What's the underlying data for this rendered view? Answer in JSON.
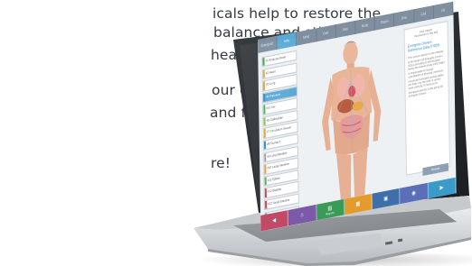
{
  "copy": {
    "lines": [
      "icals help to restore the",
      "balance and stimulates",
      "healing responses.",
      "our clients supple,",
      "and fit.",
      "re!"
    ]
  },
  "screen": {
    "tabs": [
      {
        "label": "Energetic"
      },
      {
        "label": "Info",
        "active": true
      },
      {
        "label": "Mind"
      },
      {
        "label": "Diet"
      },
      {
        "label": "Skin"
      },
      {
        "label": "Body"
      },
      {
        "label": "Organ"
      },
      {
        "label": "Dna"
      },
      {
        "label": "Cell"
      },
      {
        "label": "Oil"
      }
    ],
    "left_items": [
      {
        "label": "#1 Anatomy Brain",
        "color": "#3aa84b"
      },
      {
        "label": "#2 Heart",
        "color": "#e4a23a"
      },
      {
        "label": "#3 Lung",
        "color": "#e4a23a"
      },
      {
        "label": "#4 Pancreas",
        "color": "#2f8fcc",
        "sel": true
      },
      {
        "label": "#5 Liver",
        "color": "#4caf50"
      },
      {
        "label": "#6 Gallbladder",
        "color": "#8bc34a"
      },
      {
        "label": "#7 Circulation Sexual",
        "color": "#e4a23a"
      },
      {
        "label": "#8 Stomach",
        "color": "#2f8fcc"
      },
      {
        "label": "#9 Lung Meridian",
        "color": "#9e9e9e"
      },
      {
        "label": "#10 Large Intestine",
        "color": "#e4a23a"
      },
      {
        "label": "#11 Spleen",
        "color": "#4caf50"
      },
      {
        "label": "#12 Bladder",
        "color": "#e53935"
      },
      {
        "label": "#13 Small Intestine",
        "color": "#e53935"
      },
      {
        "label": "#14 Kidney",
        "color": "#2f8fcc"
      },
      {
        "label": "#15 Thymus",
        "color": "#e53935"
      },
      {
        "label": "#16 Thyroid",
        "color": "#9e9e9e"
      },
      {
        "label": "#17 Lymph",
        "color": "#4caf50"
      },
      {
        "label": "#18 Skin",
        "color": "#e53935"
      }
    ],
    "right_panel": {
      "title_top": "Paul Casper",
      "title_top2": "Introduction to this tool",
      "heading": "Energetic Drivers Reference Data (HD)®",
      "text": "This screen reports on the integrity of the body's 18 Energetic Drivers (EDs) according to bioenergetic theory the Human Body Field (HBF) is responsible for overall coordination of physical, chemical, neural and energetic activity within the body. For the HBF to do this work correctly, it needs to be energized and this is the job of 18 Energetic Drivers."
    },
    "bottom_buttons": [
      {
        "icon": "◀",
        "label": "",
        "color": "#c24a66"
      },
      {
        "icon": "⌂",
        "label": "",
        "color": "#7d5aa8"
      },
      {
        "icon": "▤",
        "label": "Reports",
        "color": "#3a9a57"
      },
      {
        "icon": "▦",
        "label": "",
        "color": "#e39b2b"
      },
      {
        "icon": "▣",
        "label": "",
        "color": "#3f6fa8"
      },
      {
        "icon": "◉",
        "label": "",
        "color": "#5a6fb8"
      },
      {
        "icon": "▶",
        "label": "",
        "color": "#3a9ac8"
      }
    ],
    "reflect_label": "Restart"
  },
  "colors": {
    "text": "#333842",
    "body_silver": "#d7dadd",
    "keyboard_dark": "#8a8e92"
  }
}
